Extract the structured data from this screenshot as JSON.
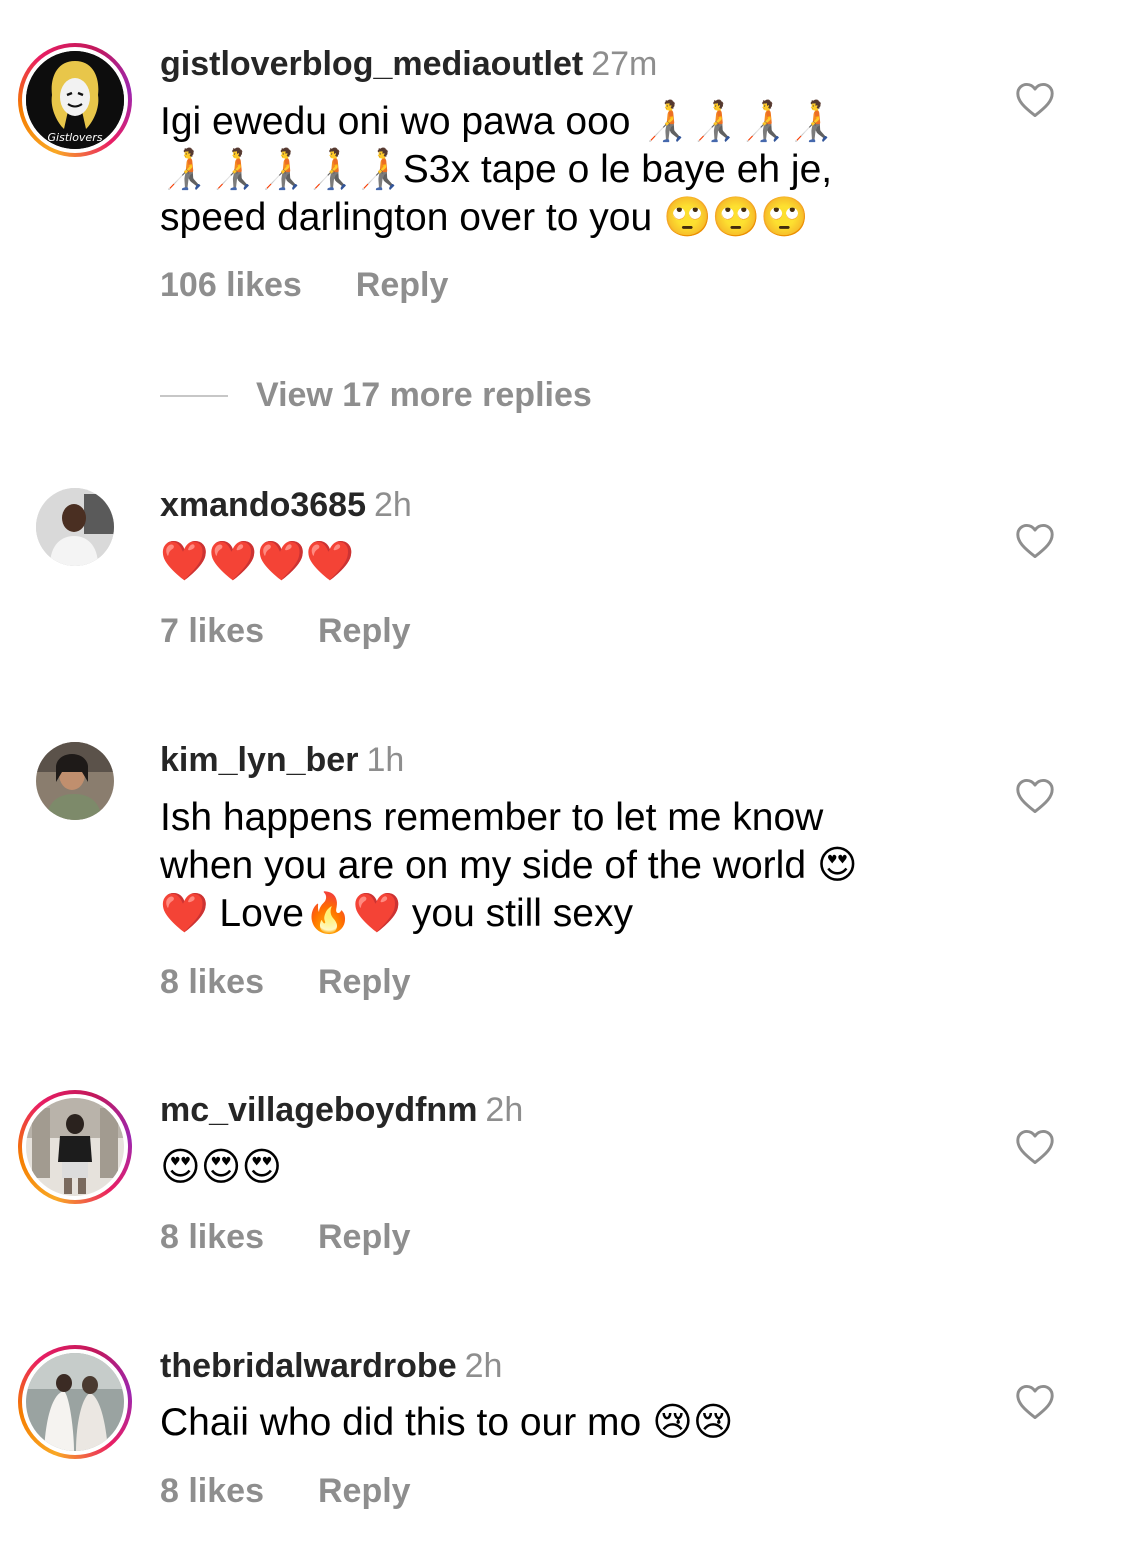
{
  "comments": [
    {
      "username": "gistloverblog_mediaoutlet",
      "time": "27m",
      "text_lines": [
        "Igi ewedu oni wo pawa ooo 🧑‍🦯🧑‍🦯🧑‍🦯🧑‍🦯",
        "🧑‍🦯🧑‍🦯🧑‍🦯🧑‍🦯🧑‍🦯S3x tape o le baye eh je,",
        "speed darlington over to you 🙄🙄🙄"
      ],
      "likes": "106 likes",
      "reply": "Reply",
      "avatar_text": "Gistlovers"
    },
    {
      "username": "xmando3685",
      "time": "2h",
      "text_lines": [
        "❤️❤️❤️❤️"
      ],
      "likes": "7 likes",
      "reply": "Reply"
    },
    {
      "username": "kim_lyn_ber",
      "time": "1h",
      "text_lines": [
        "Ish happens remember to let me know",
        "when you are on my side of the world 😍",
        "❤️ Love🔥❤️ you still sexy"
      ],
      "likes": "8 likes",
      "reply": "Reply"
    },
    {
      "username": "mc_villageboydfnm",
      "time": "2h",
      "text_lines": [
        "😍😍😍"
      ],
      "likes": "8 likes",
      "reply": "Reply"
    },
    {
      "username": "thebridalwardrobe",
      "time": "2h",
      "text_lines": [
        "Chaii who did this to our mo 😢😢"
      ],
      "likes": "8 likes",
      "reply": "Reply"
    }
  ],
  "view_replies": "View 17 more replies"
}
